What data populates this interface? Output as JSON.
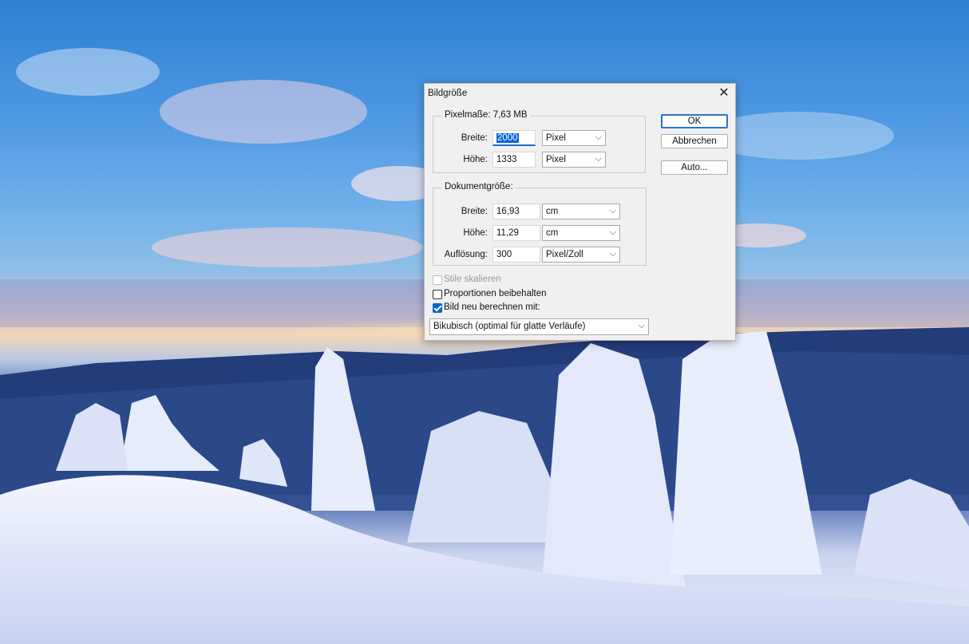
{
  "dialog": {
    "title": "Bildgröße",
    "close_glyph": "✕",
    "pixel_group": {
      "legend": "Pixelmaße: 7,63 MB",
      "width_label": "Breite:",
      "width_value": "2000",
      "width_unit": "Pixel",
      "height_label": "Höhe:",
      "height_value": "1333",
      "height_unit": "Pixel"
    },
    "document_group": {
      "legend": "Dokumentgröße:",
      "width_label": "Breite:",
      "width_value": "16,93",
      "width_unit": "cm",
      "height_label": "Höhe:",
      "height_value": "11,29",
      "height_unit": "cm",
      "resolution_label": "Auflösung:",
      "resolution_value": "300",
      "resolution_unit": "Pixel/Zoll"
    },
    "buttons": {
      "ok": "OK",
      "cancel": "Abbrechen",
      "auto": "Auto..."
    },
    "options": {
      "scale_styles": {
        "label": "Stile skalieren",
        "checked": false,
        "disabled": true
      },
      "constrain": {
        "label": "Proportionen beibehalten",
        "checked": false
      },
      "resample": {
        "label": "Bild neu berechnen mit:",
        "checked": true
      }
    },
    "resample_method": "Bikubisch (optimal für glatte Verläufe)",
    "chevron_glyph": "⌵"
  },
  "colors": {
    "accent": "#0b64c9",
    "dialog_bg": "#f0f0f0"
  }
}
